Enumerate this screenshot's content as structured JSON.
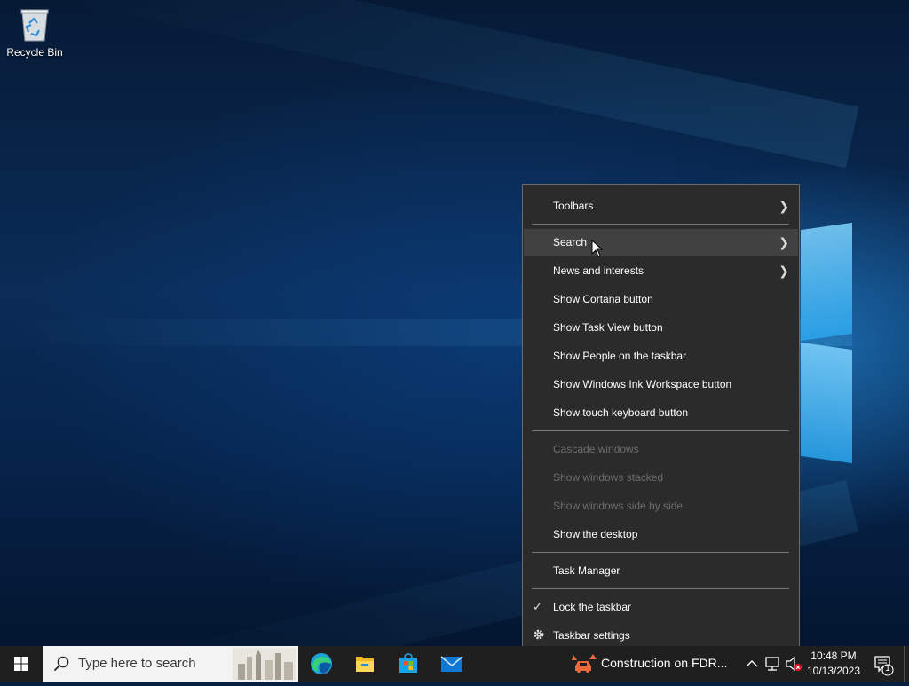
{
  "desktop": {
    "icons": [
      {
        "label": "Recycle Bin",
        "icon": "recycle-bin-icon"
      }
    ]
  },
  "context_menu": {
    "items": [
      {
        "label": "Toolbars",
        "submenu": true
      },
      {
        "label": "Search",
        "submenu": true,
        "highlighted": true
      },
      {
        "label": "News and interests",
        "submenu": true
      },
      {
        "label": "Show Cortana button"
      },
      {
        "label": "Show Task View button"
      },
      {
        "label": "Show People on the taskbar"
      },
      {
        "label": "Show Windows Ink Workspace button"
      },
      {
        "label": "Show touch keyboard button"
      },
      {
        "label": "Cascade windows",
        "disabled": true
      },
      {
        "label": "Show windows stacked",
        "disabled": true
      },
      {
        "label": "Show windows side by side",
        "disabled": true
      },
      {
        "label": "Show the desktop"
      },
      {
        "label": "Task Manager"
      },
      {
        "label": "Lock the taskbar",
        "checked": true
      },
      {
        "label": "Taskbar settings",
        "icon": "gear-icon"
      }
    ]
  },
  "taskbar": {
    "search_placeholder": "Type here to search",
    "pinned_apps": [
      "edge-icon",
      "file-explorer-icon",
      "microsoft-store-icon",
      "mail-icon"
    ],
    "news_text": "Construction on FDR...",
    "tray_icons": [
      "chevron-up-icon",
      "network-icon",
      "volume-muted-icon"
    ],
    "time": "10:48 PM",
    "date": "10/13/2023",
    "notification_count": "1"
  },
  "colors": {
    "menu_bg": "#2b2b2b",
    "menu_hover": "#414141",
    "taskbar_bg": "#1f1f1f",
    "disabled_text": "#6d6d6d"
  }
}
